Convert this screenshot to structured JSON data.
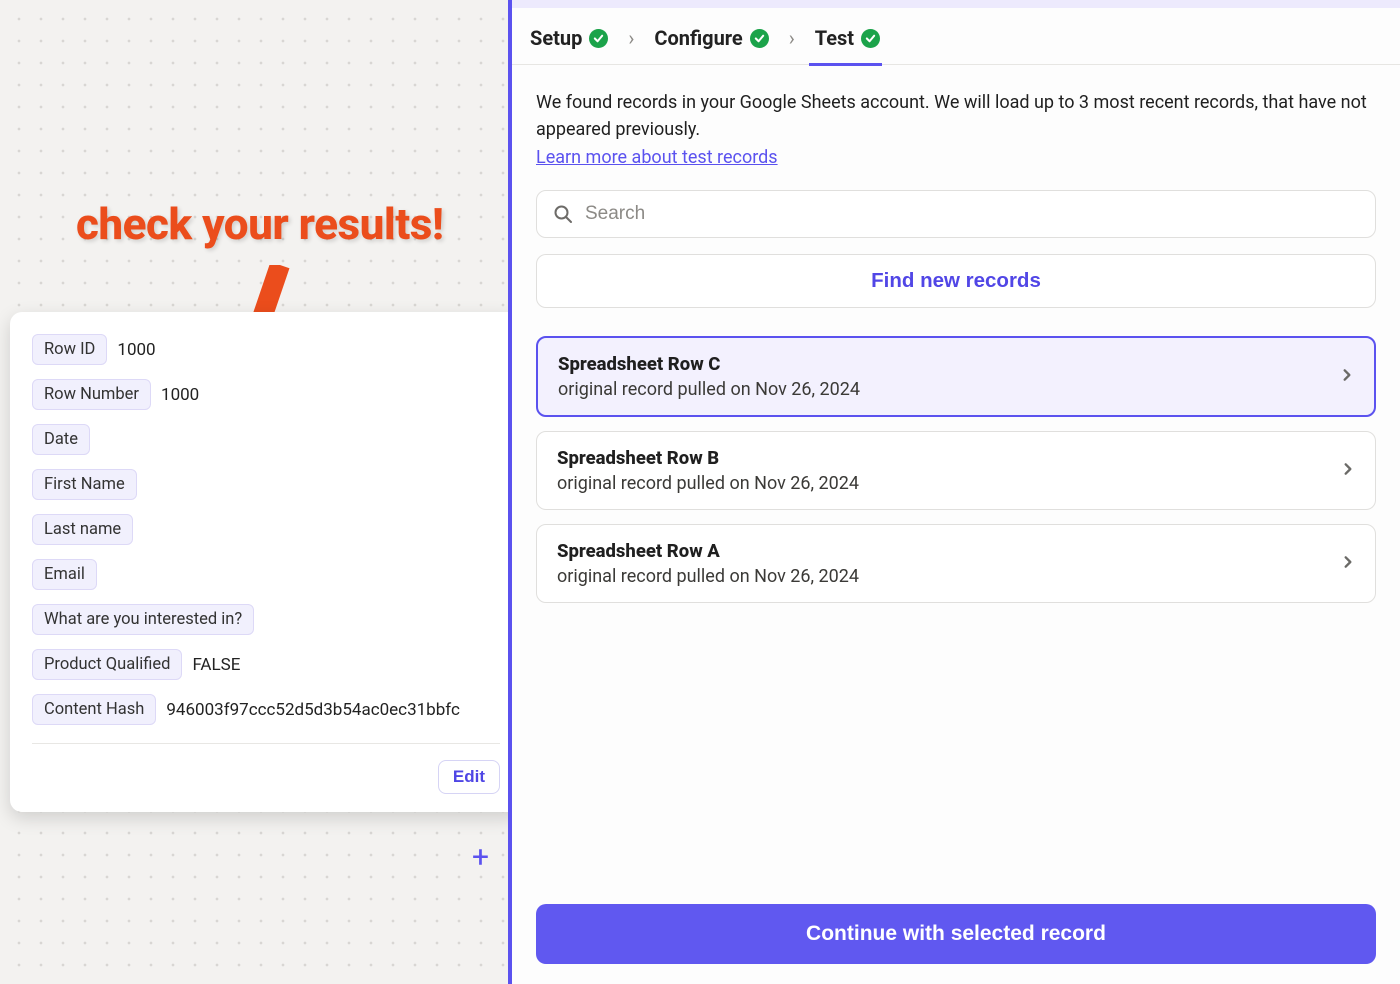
{
  "callout_text": "check your results!",
  "fields": [
    {
      "label": "Row ID",
      "value": "1000"
    },
    {
      "label": "Row Number",
      "value": "1000"
    },
    {
      "label": "Date",
      "value": ""
    },
    {
      "label": "First Name",
      "value": ""
    },
    {
      "label": "Last name",
      "value": ""
    },
    {
      "label": "Email",
      "value": ""
    },
    {
      "label": "What are you interested in?",
      "value": ""
    },
    {
      "label": "Product Qualified",
      "value": "FALSE"
    },
    {
      "label": "Content Hash",
      "value": "946003f97ccc52d5d3b54ac0ec31bbfc"
    }
  ],
  "edit_label": "Edit",
  "breadcrumb": {
    "setup": "Setup",
    "configure": "Configure",
    "test": "Test"
  },
  "instruction_text": "We found records in your Google Sheets account. We will load up to 3 most recent records, that have not appeared previously.",
  "learn_more": "Learn more about test records",
  "search_placeholder": "Search",
  "find_new_label": "Find new records",
  "records": [
    {
      "title": "Spreadsheet Row C",
      "sub": "original record pulled on Nov 26, 2024",
      "selected": true
    },
    {
      "title": "Spreadsheet Row B",
      "sub": "original record pulled on Nov 26, 2024",
      "selected": false
    },
    {
      "title": "Spreadsheet Row A",
      "sub": "original record pulled on Nov 26, 2024",
      "selected": false
    }
  ],
  "continue_label": "Continue with selected record"
}
